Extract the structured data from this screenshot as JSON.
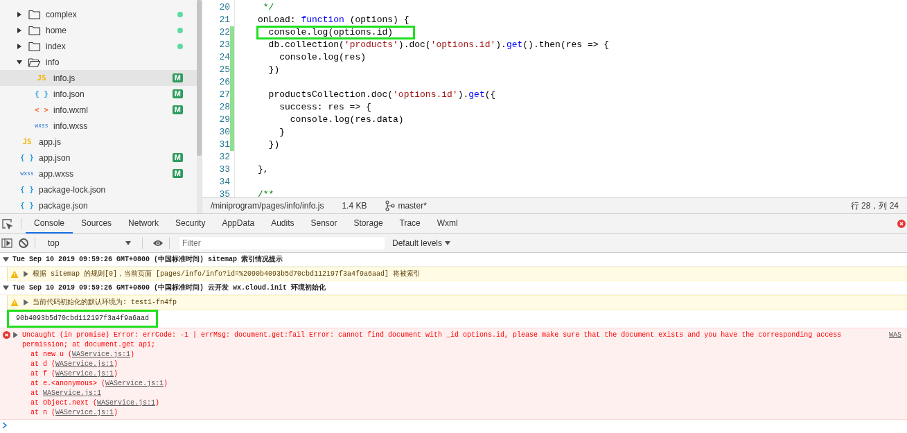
{
  "sidebar": {
    "folders": [
      {
        "name": "complex",
        "expanded": false,
        "dot": true
      },
      {
        "name": "home",
        "expanded": false,
        "dot": true
      },
      {
        "name": "index",
        "expanded": false,
        "dot": true
      },
      {
        "name": "info",
        "expanded": true,
        "dot": false,
        "children": [
          {
            "name": "info.js",
            "kind": "js",
            "icon": "JS",
            "badge": "M",
            "selected": true
          },
          {
            "name": "info.json",
            "kind": "json",
            "icon": "{ }",
            "badge": "M",
            "selected": false
          },
          {
            "name": "info.wxml",
            "kind": "wxml",
            "icon": "< >",
            "badge": "M",
            "selected": false
          },
          {
            "name": "info.wxss",
            "kind": "wxss",
            "icon": "wxss",
            "selected": false
          }
        ]
      }
    ],
    "files": [
      {
        "name": "app.js",
        "kind": "js",
        "icon": "JS",
        "selected": false
      },
      {
        "name": "app.json",
        "kind": "json",
        "icon": "{ }",
        "badge": "M",
        "selected": false
      },
      {
        "name": "app.wxss",
        "kind": "wxss",
        "icon": "wxss",
        "badge": "M",
        "selected": false
      },
      {
        "name": "package-lock.json",
        "kind": "json",
        "icon": "{ }",
        "selected": false
      },
      {
        "name": "package.json",
        "kind": "json",
        "icon": "{ }",
        "selected": false
      }
    ]
  },
  "editor": {
    "lines": [
      {
        "number": "20",
        "modified": false,
        "highlighted": false,
        "tokens": [
          {
            "kind": "comment",
            "text": " */"
          }
        ]
      },
      {
        "number": "21",
        "modified": false,
        "highlighted": false,
        "tokens": [
          {
            "kind": "plain",
            "text": "onLoad: "
          },
          {
            "kind": "keyword",
            "text": "function"
          },
          {
            "kind": "plain",
            "text": " (options) {"
          }
        ]
      },
      {
        "number": "22",
        "modified": true,
        "highlighted": true,
        "tokens": [
          {
            "kind": "plain",
            "text": "  console.log(options.id)"
          }
        ]
      },
      {
        "number": "23",
        "modified": true,
        "highlighted": false,
        "tokens": [
          {
            "kind": "plain",
            "text": "  db.collection("
          },
          {
            "kind": "string",
            "text": "'products'"
          },
          {
            "kind": "plain",
            "text": ").doc("
          },
          {
            "kind": "string",
            "text": "'options.id'"
          },
          {
            "kind": "plain",
            "text": ")."
          },
          {
            "kind": "keyword",
            "text": "get"
          },
          {
            "kind": "plain",
            "text": "().then(res => {"
          }
        ]
      },
      {
        "number": "24",
        "modified": true,
        "highlighted": false,
        "tokens": [
          {
            "kind": "plain",
            "text": "    console.log(res)"
          }
        ]
      },
      {
        "number": "25",
        "modified": true,
        "highlighted": false,
        "tokens": [
          {
            "kind": "plain",
            "text": "  })"
          }
        ]
      },
      {
        "number": "26",
        "modified": true
      },
      {
        "number": "27",
        "modified": true,
        "highlighted": false,
        "tokens": [
          {
            "kind": "plain",
            "text": "  productsCollection.doc("
          },
          {
            "kind": "string",
            "text": "'options.id'"
          },
          {
            "kind": "plain",
            "text": ")."
          },
          {
            "kind": "keyword",
            "text": "get"
          },
          {
            "kind": "plain",
            "text": "({"
          }
        ]
      },
      {
        "number": "28",
        "modified": true,
        "highlighted": false,
        "tokens": [
          {
            "kind": "plain",
            "text": "    success: res => {"
          }
        ]
      },
      {
        "number": "29",
        "modified": true,
        "highlighted": false,
        "tokens": [
          {
            "kind": "plain",
            "text": "      console.log(res.data)"
          }
        ]
      },
      {
        "number": "30",
        "modified": true,
        "highlighted": false,
        "tokens": [
          {
            "kind": "plain",
            "text": "    }"
          }
        ]
      },
      {
        "number": "31",
        "modified": true,
        "highlighted": false,
        "tokens": [
          {
            "kind": "plain",
            "text": "  })"
          }
        ]
      },
      {
        "number": "32",
        "modified": false
      },
      {
        "number": "33",
        "modified": false,
        "highlighted": false,
        "tokens": [
          {
            "kind": "plain",
            "text": "},"
          }
        ]
      },
      {
        "number": "34",
        "modified": false
      },
      {
        "number": "35",
        "modified": false,
        "highlighted": false,
        "tokens": [
          {
            "kind": "comment",
            "text": "/**"
          }
        ]
      }
    ],
    "status_bar": {
      "path": "/miniprogram/pages/info/info.js",
      "size": "1.4 KB",
      "branch": "master*",
      "cursor": "行 28，列 24"
    }
  },
  "devtools": {
    "tabs": [
      {
        "label": "Console",
        "selected": true
      },
      {
        "label": "Sources",
        "selected": false
      },
      {
        "label": "Network",
        "selected": false
      },
      {
        "label": "Security",
        "selected": false
      },
      {
        "label": "AppData",
        "selected": false
      },
      {
        "label": "Audits",
        "selected": false
      },
      {
        "label": "Sensor",
        "selected": false
      },
      {
        "label": "Storage",
        "selected": false
      },
      {
        "label": "Trace",
        "selected": false
      },
      {
        "label": "Wxml",
        "selected": false
      }
    ],
    "context": "top",
    "filter": {
      "placeholder": "Filter"
    },
    "levels": "Default levels",
    "messages": [
      {
        "kind": "group",
        "expanded": true,
        "text": "Tue Sep 10 2019 09:59:26 GMT+0800 (中国标准时间) sitemap 索引情况提示"
      },
      {
        "kind": "warning",
        "text": "根据 sitemap 的规则[0]，当前页面 [pages/info/info?id=%2090b4093b5d70cbd112197f3a4f9a6aad] 将被索引"
      },
      {
        "kind": "group",
        "expanded": true,
        "text": "Tue Sep 10 2019 09:59:26 GMT+0800 (中国标准时间) 云开发 wx.cloud.init 环境初始化"
      },
      {
        "kind": "warning",
        "text": "当前代码初始化的默认环境为: test1-fn4fp"
      },
      {
        "kind": "log",
        "highlighted": true,
        "text": "90b4093b5d70cbd112197f3a4f9a6aad"
      },
      {
        "kind": "error",
        "text": "Uncaught (in promise) Error: errCode: -1  | errMsg: document.get:fail Error: cannot find document with _id options.id, please make sure that the document exists and you have the corresponding access permission; at document.get api;",
        "source": "WAS",
        "stack": [
          {
            "prefix": "at new u (",
            "link": "WAService.js:1",
            "suffix": ")"
          },
          {
            "prefix": "at d (",
            "link": "WAService.js:1",
            "suffix": ")"
          },
          {
            "prefix": "at f (",
            "link": "WAService.js:1",
            "suffix": ")"
          },
          {
            "prefix": "at e.<anonymous> (",
            "link": "WAService.js:1",
            "suffix": ")"
          },
          {
            "prefix": "at ",
            "link": "WAService.js:1"
          },
          {
            "prefix": "at Object.next (",
            "link": "WAService.js:1",
            "suffix": ")"
          },
          {
            "prefix": "at n (",
            "link": "WAService.js:1",
            "suffix": ")"
          }
        ]
      }
    ]
  }
}
